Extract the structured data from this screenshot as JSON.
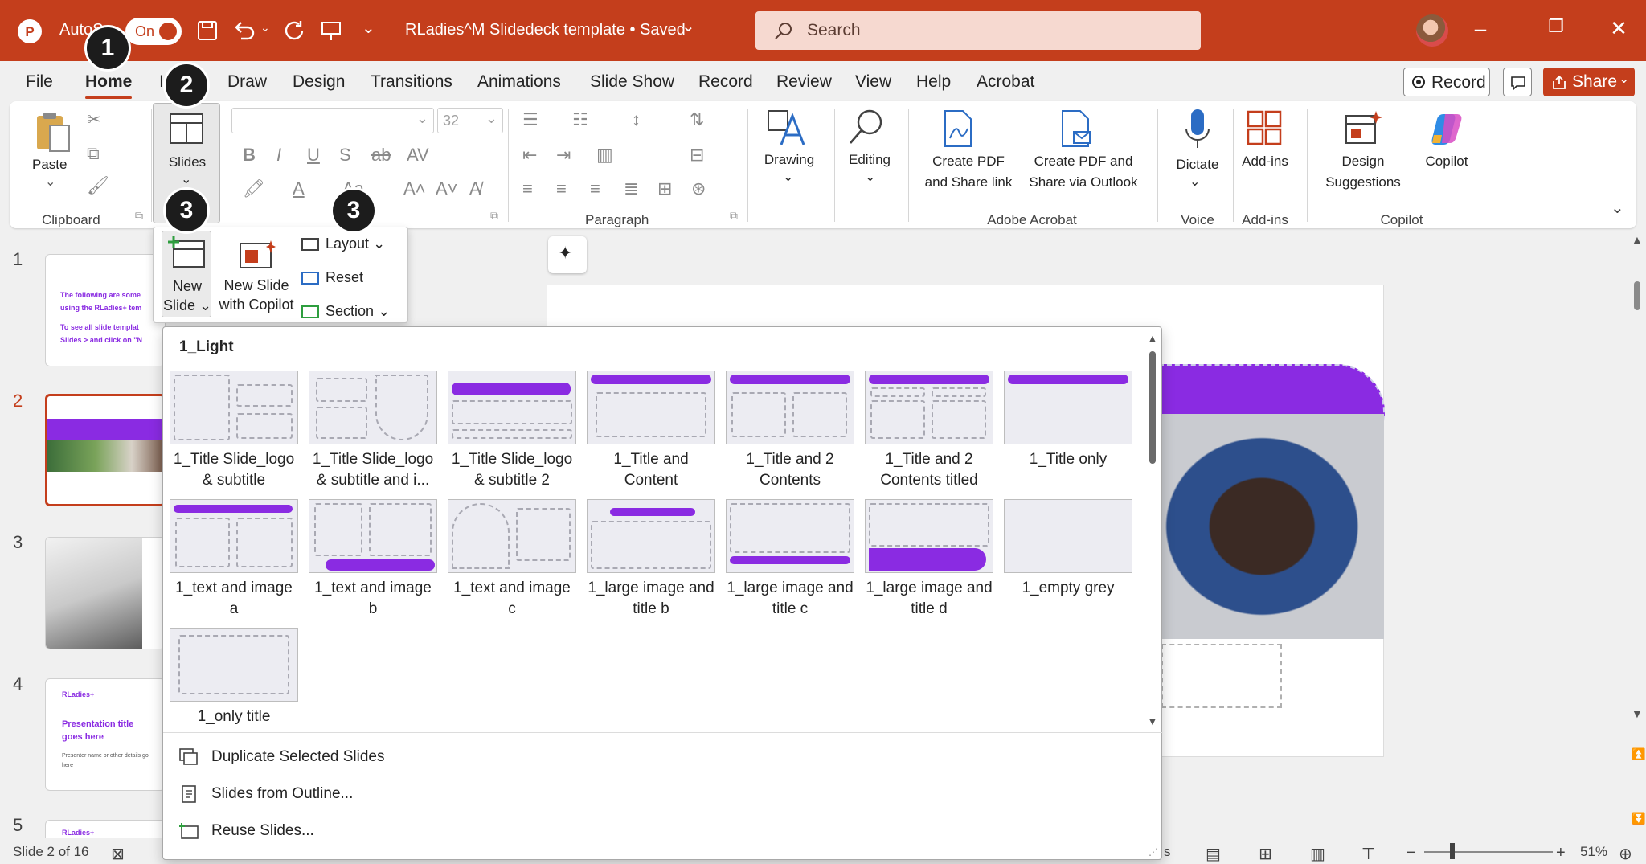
{
  "titlebar": {
    "autosave_label": "AutoS",
    "autosave_state": "On",
    "doc_title": "RLadies^M Slidedeck template • Saved",
    "search_placeholder": "Search"
  },
  "tabs": [
    "File",
    "Home",
    "In",
    "Draw",
    "Design",
    "Transitions",
    "Animations",
    "Slide Show",
    "Record",
    "Review",
    "View",
    "Help",
    "Acrobat"
  ],
  "tab_actions": {
    "record": "Record",
    "share": "Share"
  },
  "ribbon": {
    "paste": "Paste",
    "clipboard_group": "Clipboard",
    "slides": "Slides",
    "font_size": "32",
    "paragraph_group": "Paragraph",
    "drawing": "Drawing",
    "editing": "Editing",
    "create_pdf_link_1": "Create PDF",
    "create_pdf_link_2": "and Share link",
    "create_pdf_outlook_1": "Create PDF and",
    "create_pdf_outlook_2": "Share via Outlook",
    "acrobat_group": "Adobe Acrobat",
    "dictate": "Dictate",
    "voice_group": "Voice",
    "addins": "Add-ins",
    "addins_group": "Add-ins",
    "design_suggestions_1": "Design",
    "design_suggestions_2": "Suggestions",
    "copilot": "Copilot",
    "copilot_group": "Copilot"
  },
  "slides_flyout": {
    "new_slide_1": "New",
    "new_slide_2": "Slide",
    "new_slide_copilot_1": "New Slide",
    "new_slide_copilot_2": "with Copilot",
    "layout": "Layout",
    "reset": "Reset",
    "section": "Section"
  },
  "gallery": {
    "title": "1_Light",
    "layouts": [
      {
        "l1": "1_Title Slide_logo",
        "l2": "& subtitle"
      },
      {
        "l1": "1_Title Slide_logo",
        "l2": "& subtitle and i..."
      },
      {
        "l1": "1_Title Slide_logo",
        "l2": "& subtitle 2"
      },
      {
        "l1": "1_Title and",
        "l2": "Content"
      },
      {
        "l1": "1_Title and 2",
        "l2": "Contents"
      },
      {
        "l1": "1_Title and 2",
        "l2": "Contents titled"
      },
      {
        "l1": "1_Title only",
        "l2": ""
      },
      {
        "l1": "1_text and image",
        "l2": "a"
      },
      {
        "l1": "1_text and image",
        "l2": "b"
      },
      {
        "l1": "1_text and image c",
        "l2": ""
      },
      {
        "l1": "1_large image and",
        "l2": "title b"
      },
      {
        "l1": "1_large image and",
        "l2": "title c"
      },
      {
        "l1": "1_large image and",
        "l2": "title d"
      },
      {
        "l1": "1_empty grey",
        "l2": ""
      },
      {
        "l1": "1_only title",
        "l2": ""
      }
    ],
    "actions": [
      "Duplicate Selected Slides",
      "Slides from Outline...",
      "Reuse Slides..."
    ]
  },
  "slide_panel": {
    "numbers": [
      "1",
      "2",
      "3",
      "4",
      "5"
    ],
    "thumb1_lines": [
      "The following are some",
      "using the RLadies+ tem",
      "To see all slide templat",
      "Slides > and click on \"N"
    ],
    "thumb4_logo": "RLadies+",
    "thumb4_title_1": "Presentation title",
    "thumb4_title_2": "goes here",
    "thumb4_sub_1": "Presenter name or other details go",
    "thumb4_sub_2": "here",
    "thumb5_logo": "RLadies+"
  },
  "statusbar": {
    "slide_count": "Slide 2 of 16",
    "zoom": "51%",
    "notes_fragment": "s"
  },
  "callouts": [
    "1",
    "2",
    "3",
    "3"
  ],
  "colors": {
    "accent": "#c43e1c",
    "brand_purple": "#8a2be2"
  }
}
